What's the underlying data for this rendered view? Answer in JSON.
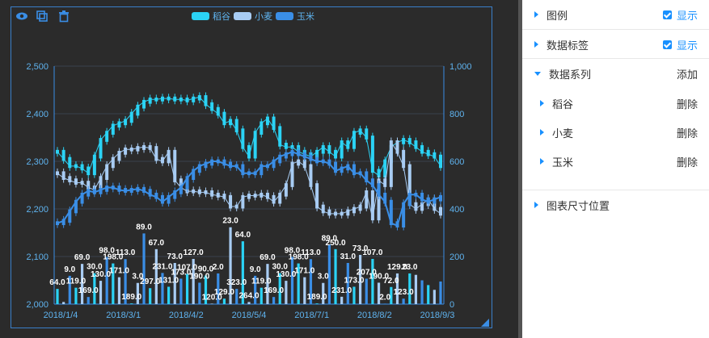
{
  "toolbar": {
    "icons": [
      "eye-icon",
      "copy-icon",
      "trash-icon"
    ]
  },
  "legend": [
    {
      "name": "稻谷",
      "color": "#2bd3f5"
    },
    {
      "name": "小麦",
      "color": "#a8ccf3"
    },
    {
      "name": "玉米",
      "color": "#3a8ee6"
    }
  ],
  "settings": {
    "legend_label": "图例",
    "legend_value": "显示",
    "data_label_label": "数据标签",
    "data_label_value": "显示",
    "series_label": "数据系列",
    "series_add": "添加",
    "series": [
      {
        "name": "稻谷",
        "action": "删除"
      },
      {
        "name": "小麦",
        "action": "删除"
      },
      {
        "name": "玉米",
        "action": "删除"
      }
    ],
    "size_label": "图表尺寸位置"
  },
  "chart_data": {
    "type": "bar",
    "x_ticks": [
      "2018/1/4",
      "2018/3/1",
      "2018/4/2",
      "2018/5/4",
      "2018/7/1",
      "2018/8/2",
      "2018/9/3"
    ],
    "y_left": {
      "min": 2000,
      "max": 2500,
      "ticks": [
        "2,000",
        "2,100",
        "2,200",
        "2,300",
        "2,400",
        "2,500"
      ]
    },
    "y_right": {
      "min": 0,
      "max": 1000,
      "ticks": [
        "0",
        "200",
        "400",
        "600",
        "800",
        "1,000"
      ]
    },
    "grid": true,
    "legend_position": "top-center",
    "candles": {
      "rice": [
        2320,
        2305,
        2290,
        2290,
        2285,
        2275,
        2310,
        2345,
        2360,
        2375,
        2380,
        2385,
        2400,
        2415,
        2425,
        2430,
        2430,
        2432,
        2432,
        2430,
        2430,
        2428,
        2432,
        2435,
        2420,
        2410,
        2400,
        2380,
        2385,
        2365,
        2330,
        2310,
        2360,
        2380,
        2390,
        2370,
        2335,
        2330,
        2330,
        2320,
        2315,
        2310,
        2320,
        2330,
        2320,
        2310,
        2340,
        2330,
        2360,
        2365,
        2350,
        2280,
        2270,
        2300,
        2330,
        2340,
        2345,
        2340,
        2330,
        2320,
        2315,
        2310,
        2290
      ],
      "wheat": [
        2275,
        2265,
        2260,
        2255,
        2255,
        2245,
        2240,
        2265,
        2290,
        2305,
        2318,
        2325,
        2325,
        2328,
        2330,
        2328,
        2305,
        2300,
        2320,
        2260,
        2245,
        2237,
        2237,
        2235,
        2235,
        2230,
        2228,
        2225,
        2205,
        2205,
        2225,
        2228,
        2228,
        2230,
        2225,
        2215,
        2230,
        2250,
        2295,
        2300,
        2290,
        2250,
        2205,
        2195,
        2190,
        2190,
        2190,
        2195,
        2200,
        2205,
        2235,
        2180,
        2260,
        2250,
        2340,
        2320,
        2290,
        2210,
        2200,
        2210,
        2220,
        2200,
        2190
      ],
      "corn": [
        2170,
        2175,
        2195,
        2215,
        2230,
        2238,
        2235,
        2240,
        2245,
        2245,
        2240,
        2238,
        2240,
        2242,
        2238,
        2230,
        2225,
        2215,
        2225,
        2235,
        2245,
        2265,
        2280,
        2290,
        2295,
        2300,
        2300,
        2295,
        2290,
        2290,
        2275,
        2275,
        2275,
        2290,
        2290,
        2300,
        2310,
        2315,
        2320,
        2315,
        2310,
        2305,
        2300,
        2300,
        2295,
        2280,
        2285,
        2290,
        2275,
        2275,
        2260,
        2250,
        2230,
        2215,
        2170,
        2165,
        2210,
        2230,
        2230,
        2220,
        2215,
        2220,
        2225
      ]
    },
    "volumes": [
      64,
      9,
      119,
      69,
      169,
      30,
      130,
      98,
      198,
      171,
      113,
      189,
      3,
      89,
      297,
      67,
      231,
      131,
      73,
      173,
      107,
      127,
      190,
      90,
      120,
      2,
      129,
      23,
      323,
      64,
      264,
      9,
      119,
      69,
      169,
      30,
      130,
      98,
      198,
      171,
      113,
      189,
      3,
      89,
      250,
      231,
      31,
      173,
      73,
      207,
      107,
      190,
      90,
      2,
      72,
      129,
      23,
      129,
      123,
      100,
      80,
      60,
      95
    ],
    "volume_labels": [
      {
        "i": 0,
        "t": "64.0"
      },
      {
        "i": 2,
        "t": "9.0"
      },
      {
        "i": 3,
        "t": "119.0"
      },
      {
        "i": 4,
        "t": "69.0"
      },
      {
        "i": 5,
        "t": "169.0"
      },
      {
        "i": 6,
        "t": "30.0"
      },
      {
        "i": 7,
        "t": "130.0"
      },
      {
        "i": 8,
        "t": "98.0"
      },
      {
        "i": 9,
        "t": "198.0"
      },
      {
        "i": 10,
        "t": "171.0"
      },
      {
        "i": 11,
        "t": "113.0"
      },
      {
        "i": 12,
        "t": "189.0"
      },
      {
        "i": 13,
        "t": "3.0"
      },
      {
        "i": 14,
        "t": "89.0"
      },
      {
        "i": 15,
        "t": "297.0"
      },
      {
        "i": 16,
        "t": "67.0"
      },
      {
        "i": 17,
        "t": "231.0"
      },
      {
        "i": 18,
        "t": "131.0"
      },
      {
        "i": 19,
        "t": "73.0"
      },
      {
        "i": 20,
        "t": "173.0"
      },
      {
        "i": 21,
        "t": "107.0"
      },
      {
        "i": 22,
        "t": "127.0"
      },
      {
        "i": 23,
        "t": "190.0"
      },
      {
        "i": 24,
        "t": "90.0"
      },
      {
        "i": 25,
        "t": "120.0"
      },
      {
        "i": 26,
        "t": "2.0"
      },
      {
        "i": 27,
        "t": "129.0"
      },
      {
        "i": 28,
        "t": "23.0"
      },
      {
        "i": 29,
        "t": "323.0"
      },
      {
        "i": 30,
        "t": "64.0"
      },
      {
        "i": 31,
        "t": "264.0"
      },
      {
        "i": 32,
        "t": "9.0"
      },
      {
        "i": 33,
        "t": "119.0"
      },
      {
        "i": 34,
        "t": "69.0"
      },
      {
        "i": 35,
        "t": "169.0"
      },
      {
        "i": 36,
        "t": "30.0"
      },
      {
        "i": 37,
        "t": "130.0"
      },
      {
        "i": 38,
        "t": "98.0"
      },
      {
        "i": 39,
        "t": "198.0"
      },
      {
        "i": 40,
        "t": "171.0"
      },
      {
        "i": 41,
        "t": "113.0"
      },
      {
        "i": 42,
        "t": "189.0"
      },
      {
        "i": 43,
        "t": "3.0"
      },
      {
        "i": 44,
        "t": "89.0"
      },
      {
        "i": 45,
        "t": "250.0"
      },
      {
        "i": 46,
        "t": "231.0"
      },
      {
        "i": 47,
        "t": "31.0"
      },
      {
        "i": 48,
        "t": "173.0"
      },
      {
        "i": 49,
        "t": "73.0"
      },
      {
        "i": 50,
        "t": "207.0"
      },
      {
        "i": 51,
        "t": "107.0"
      },
      {
        "i": 52,
        "t": "190.0"
      },
      {
        "i": 53,
        "t": "2.0"
      },
      {
        "i": 54,
        "t": "72.0"
      },
      {
        "i": 55,
        "t": "129.0"
      },
      {
        "i": 56,
        "t": "123.0"
      },
      {
        "i": 57,
        "t": "23.0"
      }
    ]
  }
}
